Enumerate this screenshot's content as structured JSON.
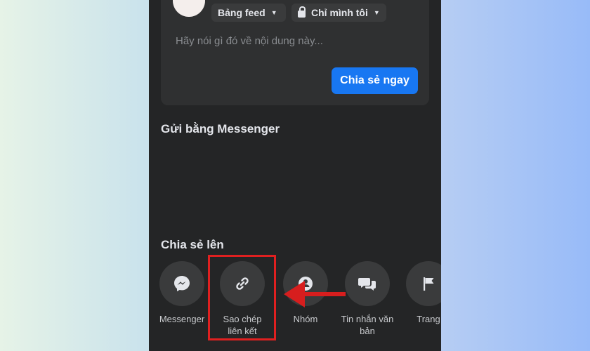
{
  "composer": {
    "audience_feed": "Bảng feed",
    "audience_privacy": "Chỉ mình tôi",
    "placeholder": "Hãy nói gì đó về nội dung này...",
    "share_now": "Chia sẻ ngay"
  },
  "messenger_section": {
    "title": "Gửi bằng Messenger"
  },
  "share_section": {
    "title": "Chia sẻ lên",
    "options": [
      {
        "label": "Messenger",
        "icon": "messenger-icon"
      },
      {
        "label": "Sao chép liên kết",
        "icon": "link-icon"
      },
      {
        "label": "Nhóm",
        "icon": "group-icon"
      },
      {
        "label": "Tin nhắn văn bản",
        "icon": "chat-bubbles-icon"
      },
      {
        "label": "Trang",
        "icon": "flag-icon"
      }
    ]
  },
  "colors": {
    "accent": "#1877f2",
    "panel": "#242526",
    "highlight": "#e02020"
  }
}
